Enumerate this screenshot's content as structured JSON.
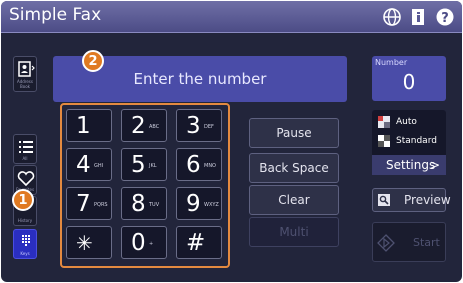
{
  "app": {
    "title": "Simple Fax"
  },
  "icons": {
    "globe": "globe-icon",
    "info": "info-icon",
    "help": "help-icon"
  },
  "sidebar": {
    "address_book": "Address Book",
    "all": "All",
    "favorites": "Favorites",
    "history": "History",
    "keys": "Keys"
  },
  "number_entry": {
    "placeholder": "Enter the number"
  },
  "number_box": {
    "label": "Number",
    "value": "0"
  },
  "keypad": [
    {
      "digit": "1",
      "letters": ""
    },
    {
      "digit": "2",
      "letters": "ABC"
    },
    {
      "digit": "3",
      "letters": "DEF"
    },
    {
      "digit": "4",
      "letters": "GHI"
    },
    {
      "digit": "5",
      "letters": "JKL"
    },
    {
      "digit": "6",
      "letters": "MNO"
    },
    {
      "digit": "7",
      "letters": "PQRS"
    },
    {
      "digit": "8",
      "letters": "TUV"
    },
    {
      "digit": "9",
      "letters": "WXYZ"
    },
    {
      "digit": "✳",
      "letters": ""
    },
    {
      "digit": "0",
      "letters": "+"
    },
    {
      "digit": "#",
      "letters": ""
    }
  ],
  "actions": {
    "pause": "Pause",
    "backspace": "Back Space",
    "clear": "Clear",
    "multi": "Multi"
  },
  "modes": {
    "auto": "Auto",
    "standard": "Standard"
  },
  "settings": {
    "label": "Settings",
    "chevron": ">"
  },
  "preview": {
    "label": "Preview"
  },
  "start": {
    "label": "Start"
  },
  "callouts": {
    "one": "1",
    "two": "2"
  },
  "colors": {
    "accent_blue": "#4a4ca8",
    "callout_orange": "#e07a22",
    "title_bar": "#5a5a96"
  }
}
